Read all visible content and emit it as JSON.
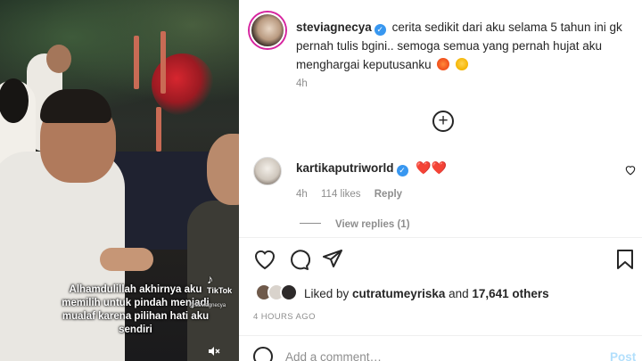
{
  "video": {
    "caption": "Alhamdulillah akhirnya aku memilih untuk pindah menjadi mualaf karena pilihan hati aku sendiri",
    "watermark_brand": "TikTok",
    "watermark_handle": "@steviagnecya",
    "mute_icon": "volume-off-icon"
  },
  "post": {
    "username": "steviagnecya",
    "caption": "cerita sedikit dari aku selama 5 tahun ini gk pernah tulis bgini.. semoga semua yang pernah hujat aku menghargai keputusanku",
    "caption_emojis": [
      "heart-with-ribbon-emoji",
      "face-blowing-kiss-emoji"
    ],
    "time": "4h",
    "load_more_icon": "plus-circle-icon"
  },
  "comment": {
    "username": "kartikaputriworld",
    "hearts": "❤️❤️",
    "time": "4h",
    "likes": "114 likes",
    "reply_label": "Reply",
    "view_replies": "View replies (1)"
  },
  "actions": {
    "icons": [
      "heart-icon",
      "comment-icon",
      "share-icon",
      "bookmark-icon"
    ]
  },
  "likes": {
    "prefix": "Liked by ",
    "user": "cutratumeyriska",
    "middle": " and ",
    "count": "17,641 others"
  },
  "post_date": "4 HOURS AGO",
  "add_comment": {
    "placeholder": "Add a comment…",
    "post_label": "Post"
  },
  "colors": {
    "verified": "#3897f0",
    "heart": "#ed4956",
    "muted_text": "#8e8e8e",
    "post_button": "#b2dffc"
  }
}
